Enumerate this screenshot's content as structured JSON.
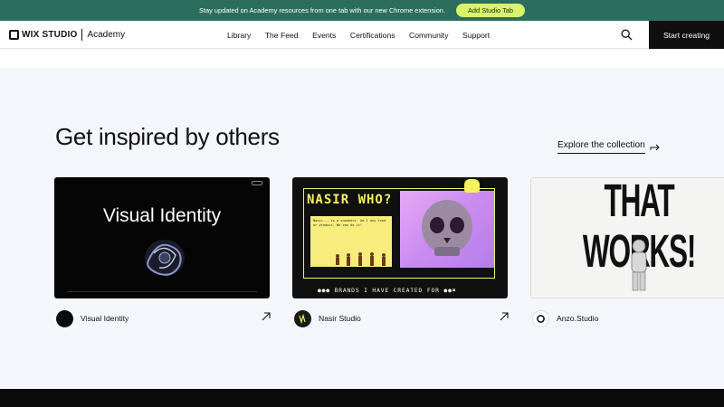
{
  "banner": {
    "text": "Stay updated on Academy resources from one tab with our new Chrome extension.",
    "button": "Add Studio Tab"
  },
  "header": {
    "logo_brand": "WIX STUDIO",
    "logo_product": "Academy",
    "nav": [
      "Library",
      "The Feed",
      "Events",
      "Certifications",
      "Community",
      "Support"
    ],
    "search_icon": "search-icon",
    "cta": "Start creating"
  },
  "section": {
    "title": "Get inspired by others",
    "explore": "Explore the collection"
  },
  "cards": [
    {
      "name": "Visual Identity",
      "preview_title": "Visual Identity",
      "arrow_icon": "arrow-up-right-icon"
    },
    {
      "name": "Nasir Studio",
      "preview_heading": "NASIR WHO?",
      "preview_footer": "BRANDS I HAVE CREATED FOR",
      "preview_note": "Nasir... is a sneakers. Am I any food or product. We can do it!",
      "arrow_icon": "arrow-up-right-icon"
    },
    {
      "name": "Anzo.Studio",
      "preview_line1": "THAT",
      "preview_line2": "WORKS!"
    }
  ],
  "colors": {
    "banner_bg": "#2c6e5d",
    "banner_button": "#d9f36b",
    "page_bg": "#f3f6fb",
    "cta_bg": "#0f0f0f"
  }
}
